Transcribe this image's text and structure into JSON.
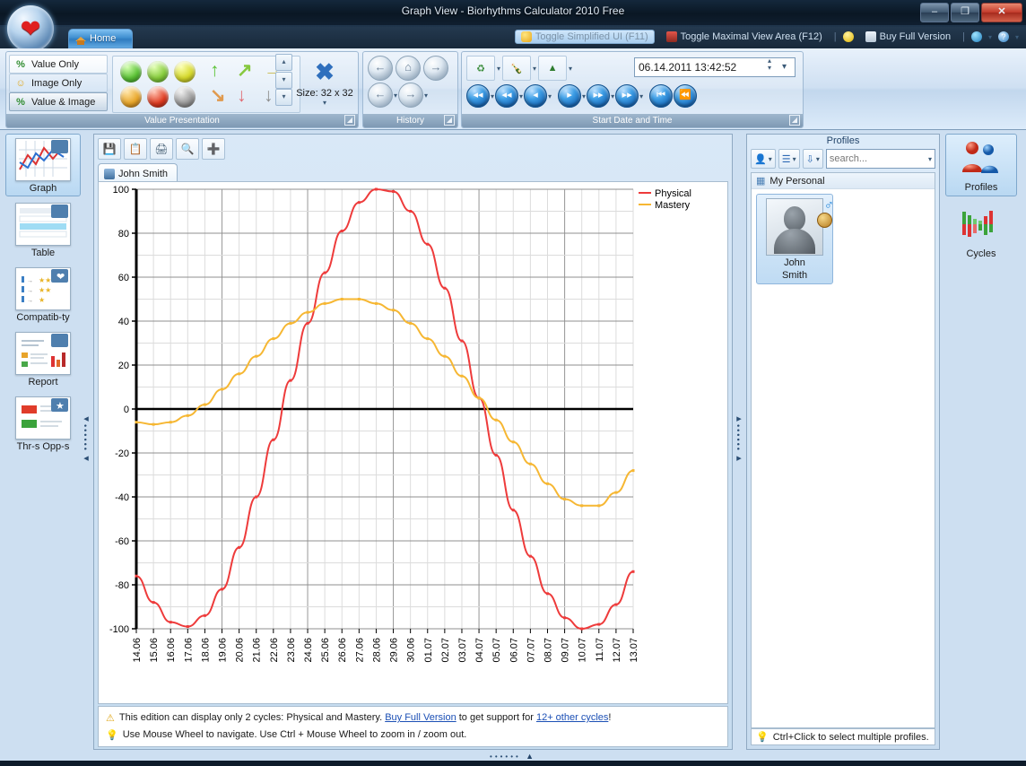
{
  "window": {
    "title": "Graph View  - Biorhythms Calculator 2010 Free",
    "minimize": "–",
    "maximize": "❐",
    "close": "✕"
  },
  "tabs": {
    "home": "Home"
  },
  "topright": {
    "toggle_simplified": "Toggle Simplified UI (F11)",
    "toggle_maximal": "Toggle Maximal View Area (F12)",
    "buy": "Buy Full Version",
    "sep": "|",
    "help": "?",
    "caret": "▾"
  },
  "ribbon": {
    "groups": {
      "value_presentation": "Value Presentation",
      "history": "History",
      "start_date": "Start Date and Time"
    },
    "value_presentation": {
      "value_only": "Value Only",
      "image_only": "Image Only",
      "value_and_image": "Value & Image",
      "size_label": "Size: 32 x 32",
      "balls": [
        "#5bc236",
        "#76cc3c",
        "#d6d92b",
        "#e8a62a",
        "#df3c22",
        "#9a9a9a"
      ],
      "arrows": [
        "↑",
        "↗",
        "→",
        "↘",
        "↓",
        "↓"
      ],
      "arrow_colors": [
        "#5bc236",
        "#86c83e",
        "#c9b84a",
        "#e09a4e",
        "#e06a72",
        "#8d8d8d"
      ],
      "spin_up": "▴",
      "spin_down": "▾",
      "more": "▾"
    },
    "history": {
      "back": "←",
      "home": "⌂",
      "forward": "→",
      "back2": "←",
      "forward2": "→",
      "caret": "▾"
    },
    "start_date": {
      "value": "06.14.2011 13:42:52",
      "spin_up": "▴",
      "spin_down": "▾",
      "dropdown": "▾",
      "presets": [
        "today-icon",
        "birthday-icon",
        "holiday-icon"
      ],
      "nav_buttons": [
        "◀◀◀",
        "◀◀",
        "◀",
        "▶",
        "▶▶",
        "▶▶▶",
        "⏮",
        "⏪"
      ]
    }
  },
  "left_nav": {
    "items": [
      {
        "label": "Graph",
        "icon": "graph-icon",
        "selected": true
      },
      {
        "label": "Table",
        "icon": "table-icon",
        "selected": false
      },
      {
        "label": "Compatib-ty",
        "icon": "compatibility-icon",
        "selected": false
      },
      {
        "label": "Report",
        "icon": "report-icon",
        "selected": false
      },
      {
        "label": "Thr-s  Opp-s",
        "icon": "threats-opportunities-icon",
        "selected": false
      }
    ]
  },
  "doc": {
    "toolbar": [
      "save-icon",
      "copy-icon",
      "print-icon",
      "print-preview-icon",
      "add-icon"
    ],
    "tab_label": "John Smith"
  },
  "notes": {
    "warning_pre": "This edition can display only 2 cycles: Physical and Mastery. ",
    "warning_link": "Buy Full Version",
    "warning_mid": " to get support for ",
    "warning_link2": "12+  other cycles",
    "warning_end": "!",
    "hint": "Use Mouse Wheel to navigate. Use Ctrl + Mouse Wheel to zoom in / zoom out."
  },
  "profiles": {
    "header": "Profiles",
    "search_placeholder": "search...",
    "group_label": "My Personal",
    "card_name_line1": "John",
    "card_name_line2": "Smith",
    "gender_badge": "♂",
    "hint": "Ctrl+Click to select multiple profiles.",
    "toolbar": [
      "add-profile-icon",
      "list-view-icon",
      "sort-icon"
    ]
  },
  "right_nav": {
    "items": [
      {
        "label": "Profiles",
        "icon": "profiles-icon",
        "selected": true
      },
      {
        "label": "Cycles",
        "icon": "cycles-icon",
        "selected": false
      }
    ]
  },
  "chart_data": {
    "type": "line",
    "title": "",
    "xlabel": "",
    "ylabel": "",
    "ylim": [
      -100,
      100
    ],
    "yticks": [
      100,
      80,
      60,
      40,
      20,
      0,
      -20,
      -40,
      -60,
      -80,
      -100
    ],
    "grid": true,
    "legend_position": "top-right",
    "categories": [
      "14.06",
      "15.06",
      "16.06",
      "17.06",
      "18.06",
      "19.06",
      "20.06",
      "21.06",
      "22.06",
      "23.06",
      "24.06",
      "25.06",
      "26.06",
      "27.06",
      "28.06",
      "29.06",
      "30.06",
      "01.07",
      "02.07",
      "03.07",
      "04.07",
      "05.07",
      "06.07",
      "07.07",
      "08.07",
      "09.07",
      "10.07",
      "11.07",
      "12.07",
      "13.07"
    ],
    "series": [
      {
        "name": "Physical",
        "color": "#ee3b3b",
        "values": [
          -76,
          -88,
          -97,
          -99,
          -94,
          -82,
          -63,
          -40,
          -14,
          13,
          39,
          62,
          81,
          94,
          100,
          99,
          90,
          75,
          55,
          31,
          5,
          -21,
          -46,
          -67,
          -84,
          -95,
          -100,
          -98,
          -89,
          -74
        ]
      },
      {
        "name": "Mastery",
        "color": "#f6b733",
        "values": [
          -6,
          -7,
          -6,
          -3,
          2,
          9,
          16,
          24,
          32,
          39,
          44,
          48,
          50,
          50,
          48,
          45,
          39,
          32,
          24,
          15,
          5,
          -5,
          -15,
          -25,
          -34,
          -41,
          -44,
          -44,
          -38,
          -28
        ]
      }
    ]
  }
}
